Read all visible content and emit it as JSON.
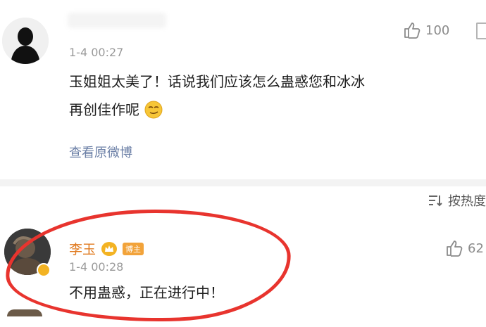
{
  "comment": {
    "timestamp": "1-4 00:27",
    "likes": "100",
    "text_line1": "玉姐姐太美了！话说我们应该怎么蛊惑您和冰冰",
    "text_line2": "再创佳作呢",
    "view_original": "查看原微博"
  },
  "sort": {
    "label": "按热度"
  },
  "reply": {
    "username": "李玉",
    "badge_label": "博主",
    "timestamp": "1-4 00:28",
    "likes": "62",
    "text": "不用蛊惑，正在进行中！"
  },
  "colors": {
    "username": "#e07a1f",
    "link": "#6b7fa6",
    "annotation_circle": "#e8342e"
  }
}
